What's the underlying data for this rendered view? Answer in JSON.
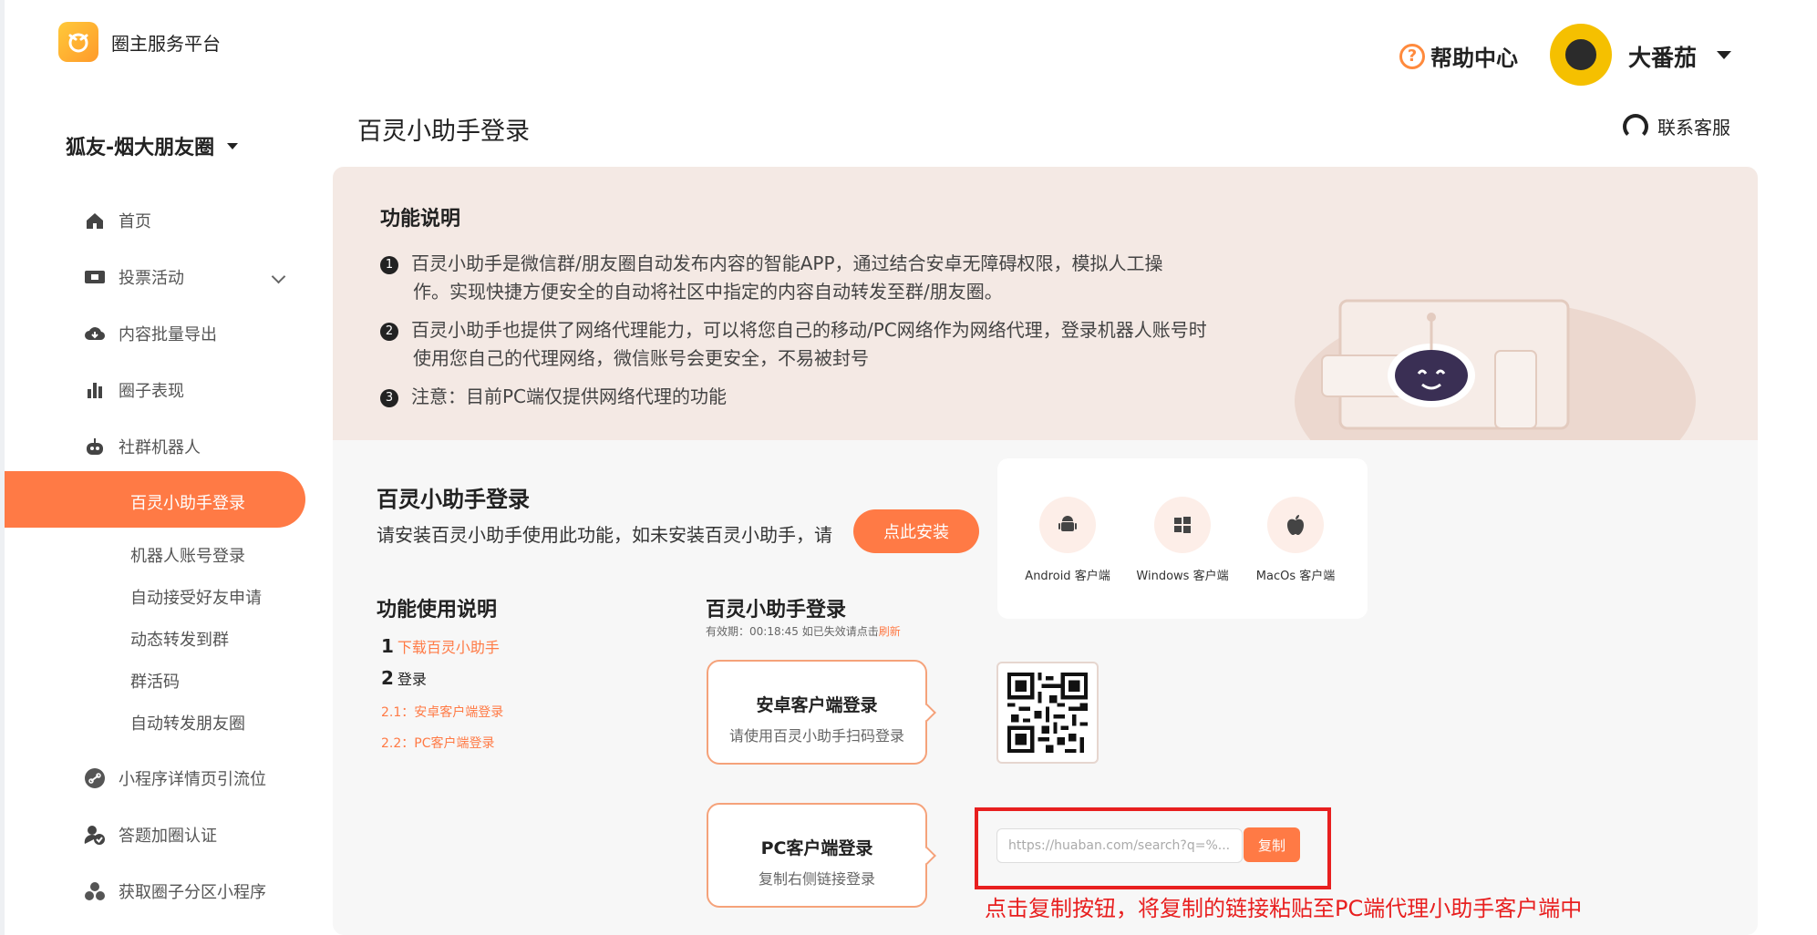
{
  "app": {
    "name": "圈主服务平台"
  },
  "header": {
    "help_label": "帮助中心",
    "user_name": "大番茄"
  },
  "circle": {
    "selected": "狐友-烟大朋友圈"
  },
  "sidebar": {
    "items": [
      {
        "label": "首页"
      },
      {
        "label": "投票活动"
      },
      {
        "label": "内容批量导出"
      },
      {
        "label": "圈子表现"
      },
      {
        "label": "社群机器人"
      }
    ],
    "active_item": "百灵小助手登录",
    "sub_items": [
      {
        "label": "机器人账号登录"
      },
      {
        "label": "自动接受好友申请"
      },
      {
        "label": "动态转发到群"
      },
      {
        "label": "群活码"
      },
      {
        "label": "自动转发朋友圈"
      }
    ],
    "bottom_items": [
      {
        "label": "小程序详情页引流位"
      },
      {
        "label": "答题加圈认证"
      },
      {
        "label": "获取圈子分区小程序"
      }
    ]
  },
  "page": {
    "title": "百灵小助手登录",
    "contact_label": "联系客服"
  },
  "intro": {
    "title": "功能说明",
    "lines": [
      {
        "num": "1",
        "line1": "百灵小助手是微信群/朋友圈自动发布内容的智能APP，通过结合安卓无障碍权限，模拟人工操",
        "line2": "作。实现快捷方便安全的自动将社区中指定的内容自动转发至群/朋友圈。"
      },
      {
        "num": "2",
        "line1": "百灵小助手也提供了网络代理能力，可以将您自己的移动/PC网络作为网络代理，登录机器人账号时",
        "line2": "使用您自己的代理网络，微信账号会更安全，不易被封号"
      },
      {
        "num": "3",
        "line1": "注意：目前PC端仅提供网络代理的功能"
      }
    ]
  },
  "install": {
    "title": "百灵小助手登录",
    "desc": "请安装百灵小助手使用此功能，如未安装百灵小助手，请",
    "button": "点此安装",
    "clients": [
      {
        "label": "Android 客户端",
        "icon": "android-icon"
      },
      {
        "label": "Windows 客户端",
        "icon": "windows-icon"
      },
      {
        "label": "MacOs 客户端",
        "icon": "apple-icon"
      }
    ]
  },
  "usage": {
    "title": "功能使用说明",
    "step1_num": "1",
    "step1": "下载百灵小助手",
    "step2_num": "2",
    "step2": "登录",
    "step21": "2.1：安卓客户端登录",
    "step22": "2.2：PC客户端登录"
  },
  "login": {
    "title": "百灵小助手登录",
    "validity_prefix": "有效期：00:18:45 如已失效请点击",
    "refresh": "刷新",
    "android_card": {
      "title": "安卓客户端登录",
      "subtitle": "请使用百灵小助手扫码登录"
    },
    "pc_card": {
      "title": "PC客户端登录",
      "subtitle": "复制右侧链接登录"
    },
    "url": "https://huaban.com/search?q=%...",
    "copy_button": "复制",
    "note": "点击复制按钮，将复制的链接粘贴至PC端代理小助手客户端中"
  },
  "colors": {
    "accent": "#ff7a45",
    "annotation": "#e81f1f",
    "intro_bg": "#f4e9e4"
  }
}
